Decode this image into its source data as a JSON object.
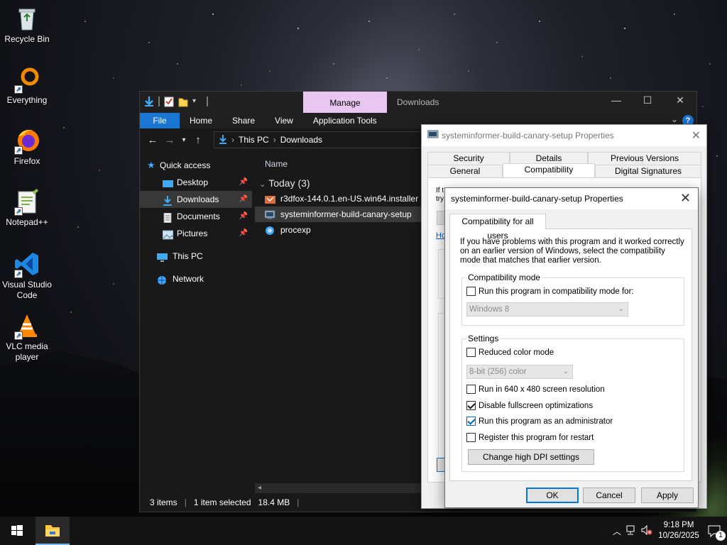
{
  "desktop": {
    "icons": [
      {
        "label": "Recycle Bin",
        "icon": "recycle-bin-icon"
      },
      {
        "label": "Everything",
        "icon": "everything-icon"
      },
      {
        "label": "Firefox",
        "icon": "firefox-icon"
      },
      {
        "label": "Notepad++",
        "icon": "notepadpp-icon"
      },
      {
        "label": "Visual Studio Code",
        "icon": "vscode-icon"
      },
      {
        "label": "VLC media player",
        "icon": "vlc-icon"
      }
    ]
  },
  "explorer": {
    "manage_tab": "Manage",
    "title": "Downloads",
    "ribbon": {
      "file": "File",
      "home": "Home",
      "share": "Share",
      "view": "View",
      "app_tools": "Application Tools"
    },
    "address": {
      "this_pc": "This PC",
      "downloads": "Downloads"
    },
    "nav": {
      "quick_access": "Quick access",
      "desktop": "Desktop",
      "downloads": "Downloads",
      "documents": "Documents",
      "pictures": "Pictures",
      "this_pc": "This PC",
      "network": "Network"
    },
    "column_name": "Name",
    "group_label": "Today (3)",
    "files": [
      {
        "name": "r3dfox-144.0.1.en-US.win64.installer",
        "icon": "firefox-installer-icon"
      },
      {
        "name": "systeminformer-build-canary-setup",
        "icon": "setup-icon"
      },
      {
        "name": "procexp",
        "icon": "procexp-icon"
      }
    ],
    "status": {
      "items": "3 items",
      "selected": "1 item selected",
      "size": "18.4 MB"
    }
  },
  "props_back": {
    "title": "systeminformer-build-canary-setup Properties",
    "tabs_row1": [
      "Security",
      "Details",
      "Previous Versions"
    ],
    "tabs_row2": [
      "General",
      "Compatibility",
      "Digital Signatures"
    ],
    "partial": {
      "if": "If t",
      "try": "try",
      "how": "Ho"
    }
  },
  "props_front": {
    "title": "systeminformer-build-canary-setup Properties",
    "tab": "Compatibility for all users",
    "intro": "If you have problems with this program and it worked correctly on an earlier version of Windows, select the compatibility mode that matches that earlier version.",
    "compat_group": "Compatibility mode",
    "compat_check": "Run this program in compatibility mode for:",
    "compat_select": "Windows 8",
    "settings_group": "Settings",
    "reduced_color": "Reduced color mode",
    "color_select": "8-bit (256) color",
    "res_640": "Run in 640 x 480 screen resolution",
    "disable_fullscreen": "Disable fullscreen optimizations",
    "run_admin": "Run this program as an administrator",
    "register_restart": "Register this program for restart",
    "dpi_button": "Change high DPI settings",
    "ok": "OK",
    "cancel": "Cancel",
    "apply": "Apply",
    "checked": {
      "compat": false,
      "reduced": false,
      "res": false,
      "fullscreen": true,
      "admin": true,
      "restart": false
    }
  },
  "taskbar": {
    "time": "9:18 PM",
    "date": "10/26/2025",
    "notification_count": "1"
  },
  "colors": {
    "accent": "#0078d7",
    "manage_tab": "#e8c8f0",
    "file_tab": "#1976d2"
  }
}
